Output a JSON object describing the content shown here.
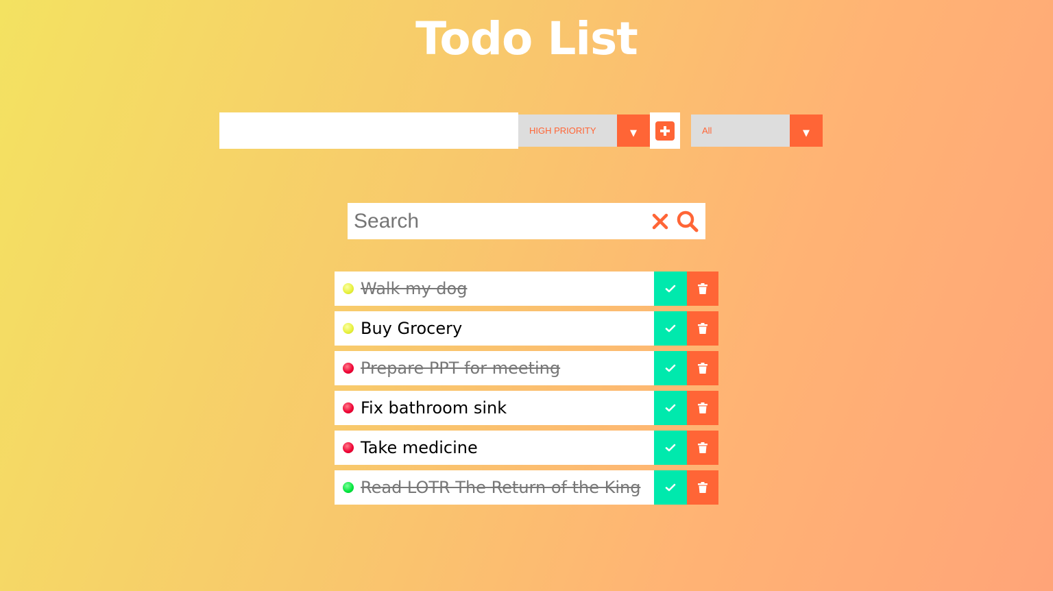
{
  "header": {
    "title": "Todo List"
  },
  "form": {
    "todo_value": "",
    "priority_selected": "HIGH PRIORITY",
    "filter_selected": "All",
    "add_icon": "plus-icon",
    "dropdown_icon": "caret-down-icon"
  },
  "search": {
    "placeholder": "Search",
    "value": "",
    "clear_icon": "close-icon",
    "search_icon": "search-icon"
  },
  "colors": {
    "accent": "#ff6536",
    "check": "#00e9ad",
    "priority_low": "#00ee44",
    "priority_medium": "#e8f23a",
    "priority_high": "#ee0033"
  },
  "todos": [
    {
      "text": "Walk my dog",
      "priority": "medium",
      "completed": true
    },
    {
      "text": "Buy Grocery",
      "priority": "medium",
      "completed": false
    },
    {
      "text": "Prepare PPT for meeting",
      "priority": "high",
      "completed": true
    },
    {
      "text": "Fix bathroom sink",
      "priority": "high",
      "completed": false
    },
    {
      "text": "Take medicine",
      "priority": "high",
      "completed": false
    },
    {
      "text": "Read LOTR The Return of the King",
      "priority": "low",
      "completed": true
    }
  ]
}
